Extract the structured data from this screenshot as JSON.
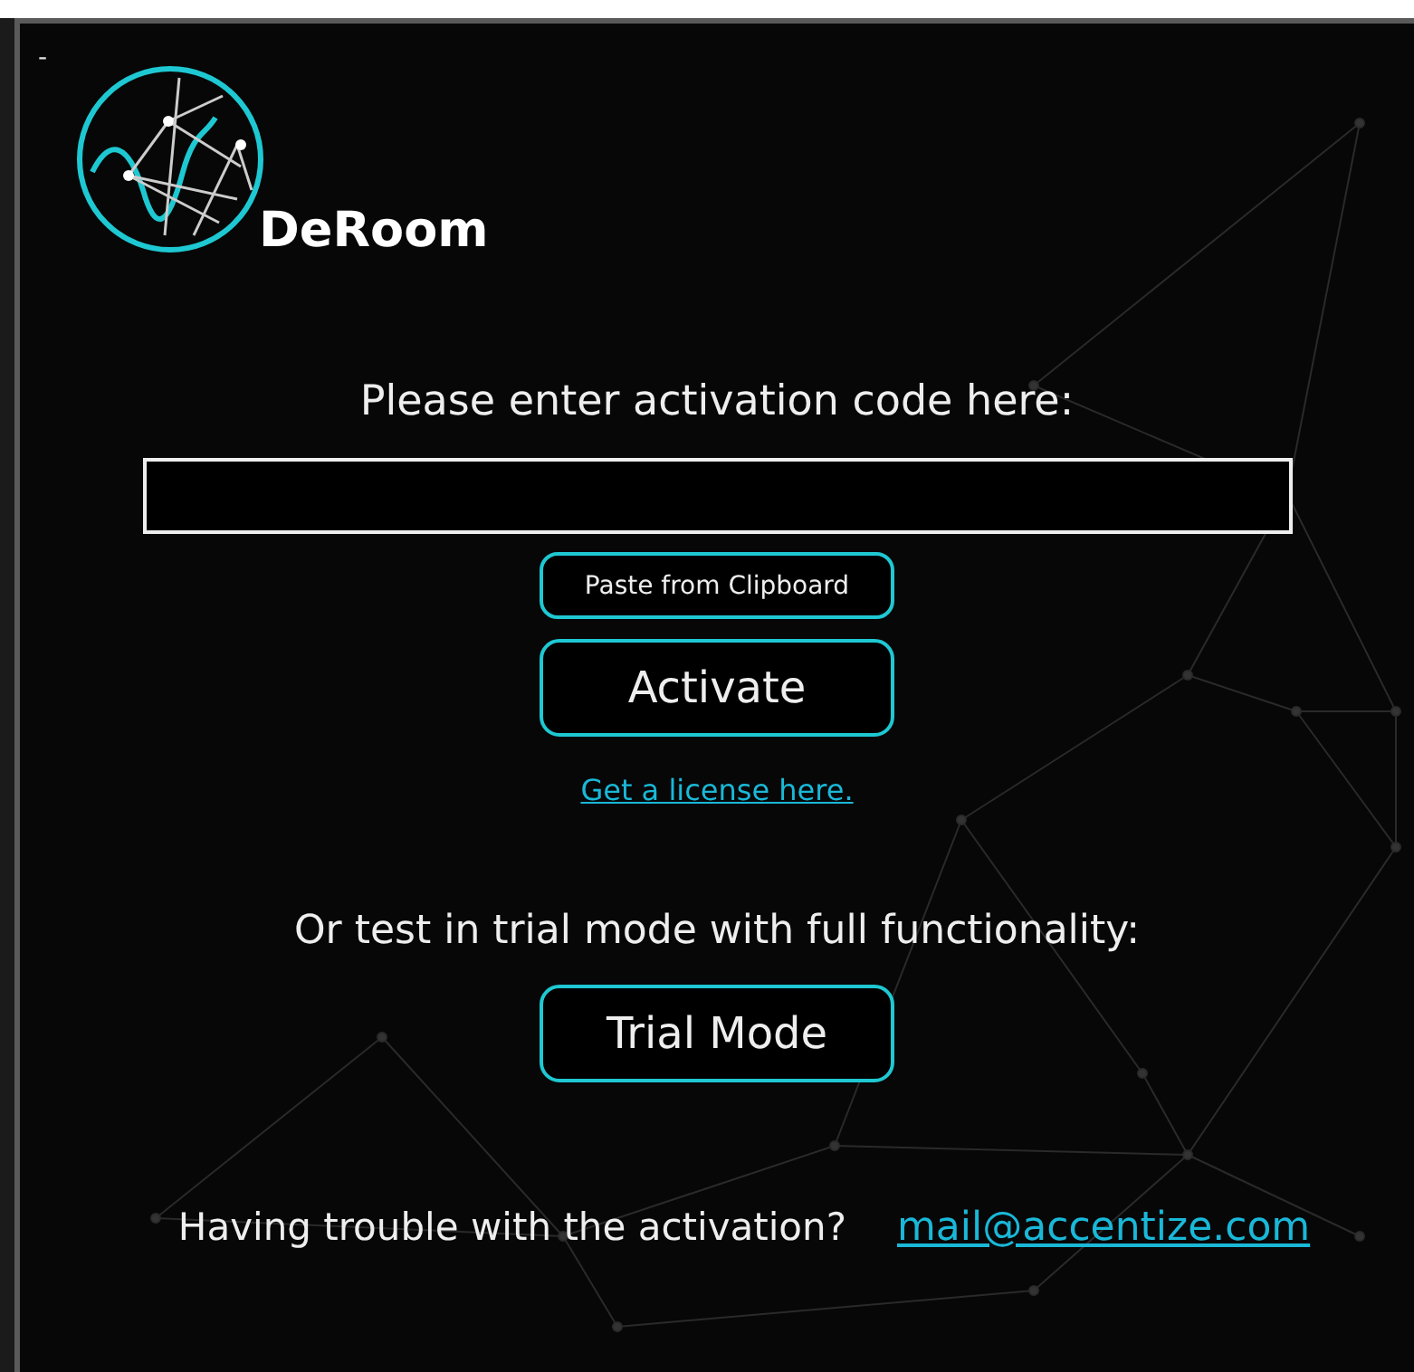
{
  "window": {
    "minimize_label": "-"
  },
  "app_name": "DeRoom",
  "prompt": "Please enter activation code here:",
  "paste_button": "Paste from Clipboard",
  "activate_button": "Activate",
  "license_link": "Get a license here.",
  "trial_prompt": "Or test in trial mode with full functionality:",
  "trial_button": "Trial Mode",
  "footer": {
    "question": "Having trouble with the activation?",
    "email": "mail@accentize.com"
  }
}
